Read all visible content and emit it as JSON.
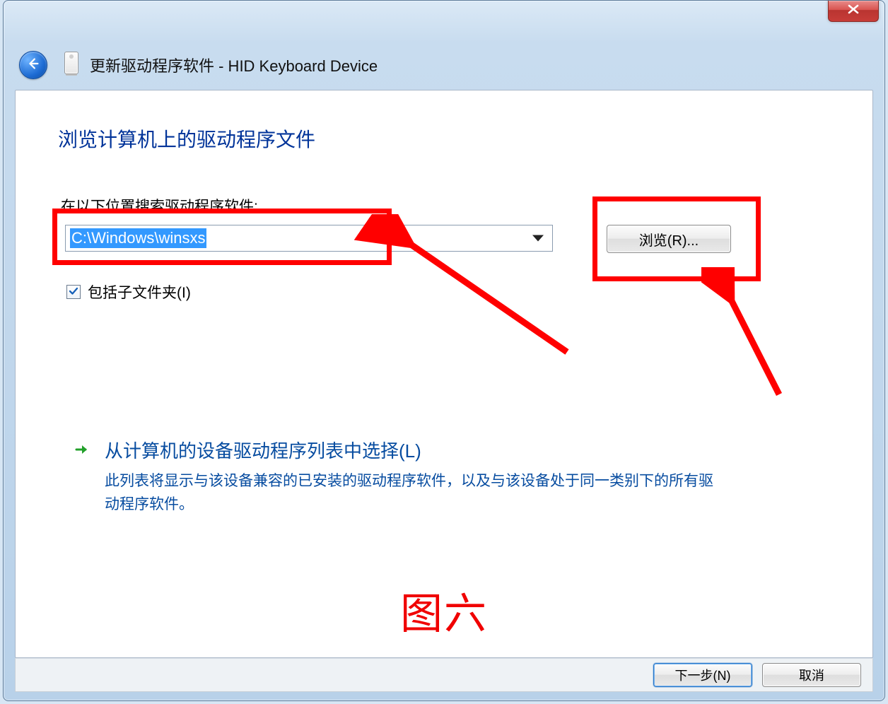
{
  "window": {
    "title": "更新驱动程序软件 - HID Keyboard Device"
  },
  "main": {
    "instruction": "浏览计算机上的驱动程序文件",
    "search_label": "在以下位置搜索驱动程序软件:",
    "path_value": "C:\\Windows\\winsxs",
    "browse_label": "浏览(R)...",
    "include_subfolders_label": "包括子文件夹(I)",
    "include_subfolders_checked": true,
    "command_link": {
      "title": "从计算机的设备驱动程序列表中选择(L)",
      "description": "此列表将显示与该设备兼容的已安装的驱动程序软件，以及与该设备处于同一类别下的所有驱动程序软件。"
    }
  },
  "footer": {
    "next_label": "下一步(N)",
    "cancel_label": "取消"
  },
  "annotation": {
    "caption": "图六",
    "color": "#ff0000"
  }
}
